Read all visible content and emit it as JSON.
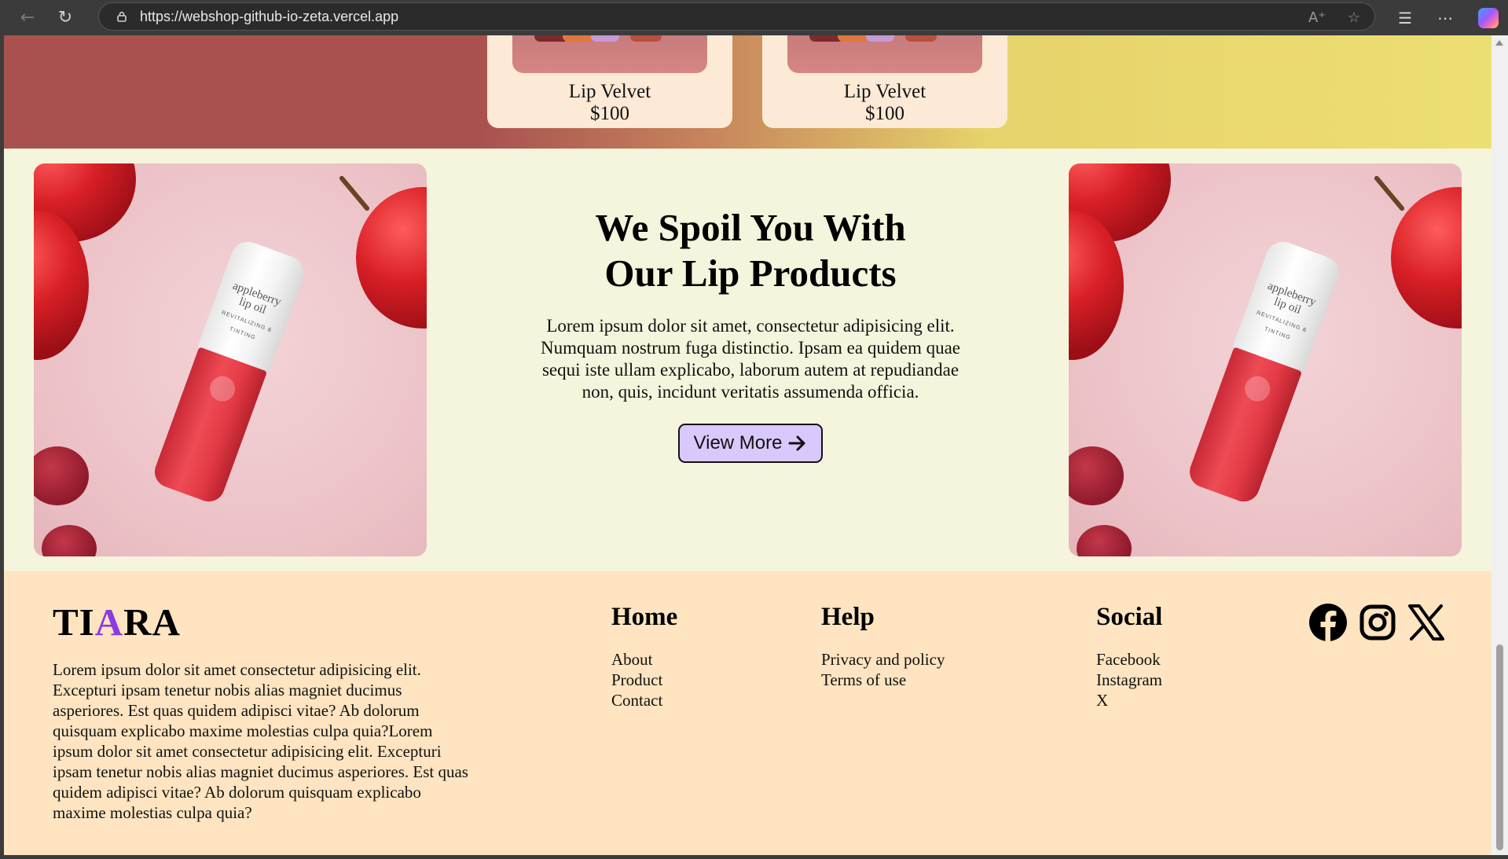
{
  "browser": {
    "url": "https://webshop-github-io-zeta.vercel.app",
    "icons": [
      "back-icon",
      "refresh-icon",
      "lock-icon",
      "read-aloud-icon",
      "star-icon",
      "favorites-icon",
      "more-icon",
      "copilot-icon"
    ]
  },
  "products": [
    {
      "name": "Lip Velvet",
      "price": "$100"
    },
    {
      "name": "Lip Velvet",
      "price": "$100"
    }
  ],
  "promo": {
    "title_line1": "We Spoil You With",
    "title_line2": "Our Lip Products",
    "body": "Lorem ipsum dolor sit amet, consectetur adipisicing elit. Numquam nostrum fuga distinctio. Ipsam ea quidem quae sequi iste ullam explicabo, laborum autem at repudiandae non, quis, incidunt veritatis assumenda officia.",
    "button_label": "View More",
    "product_label_line1": "appleberry",
    "product_label_line2": "lip oil",
    "product_label_small": "REVITALIZING & TINTING"
  },
  "footer": {
    "logo_part1": "TI",
    "logo_accent": "A",
    "logo_part2": "RA",
    "description": "Lorem ipsum dolor sit amet consectetur adipisicing elit. Excepturi ipsam tenetur nobis alias magniet ducimus asperiores. Est quas quidem adipisci vitae? Ab dolorum quisquam explicabo maxime molestias culpa quia?Lorem ipsum dolor sit amet consectetur adipisicing elit. Excepturi ipsam tenetur nobis alias magniet ducimus asperiores. Est quas quidem adipisci vitae? Ab dolorum quisquam explicabo maxime molestias culpa quia?",
    "columns": [
      {
        "heading": "Home",
        "links": [
          "About",
          "Product",
          "Contact"
        ]
      },
      {
        "heading": "Help",
        "links": [
          "Privacy and policy",
          "Terms of use"
        ]
      },
      {
        "heading": "Social",
        "links": [
          "Facebook",
          "Instagram",
          "X"
        ]
      }
    ],
    "social_icons": [
      "facebook-icon",
      "instagram-icon",
      "x-icon"
    ]
  },
  "colors": {
    "accent": "#8b3bde",
    "button_bg": "#d9c8fb",
    "footer_bg": "#fee4c0",
    "promo_bg": "#f5f4dc"
  }
}
